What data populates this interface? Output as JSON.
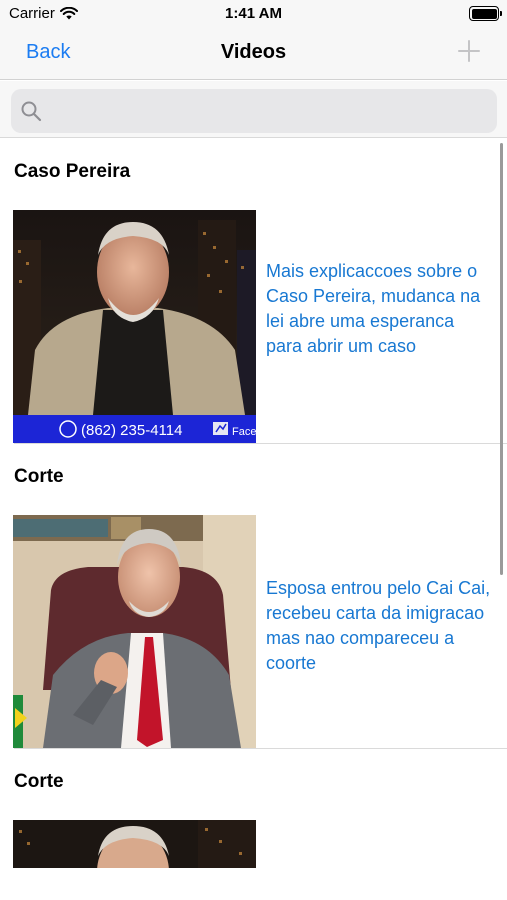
{
  "status_bar": {
    "carrier": "Carrier",
    "time": "1:41 AM"
  },
  "nav": {
    "back_label": "Back",
    "title": "Videos"
  },
  "search": {
    "placeholder": ""
  },
  "sections": [
    {
      "header": "Caso Pereira",
      "video_title": "Mais explicaccoes sobre o Caso Pereira, mudanca na lei abre uma esperanca para abrir um caso",
      "phone_banner": "(862) 235-4114",
      "banner_tag": "Face"
    },
    {
      "header": "Corte",
      "video_title": "Esposa entrou pelo Cai Cai, recebeu carta da imigracao mas nao compareceu a coorte"
    },
    {
      "header": "Corte"
    }
  ],
  "colors": {
    "accent": "#1b7cf2",
    "link_text": "#1878d2",
    "banner": "#1c25d6"
  }
}
